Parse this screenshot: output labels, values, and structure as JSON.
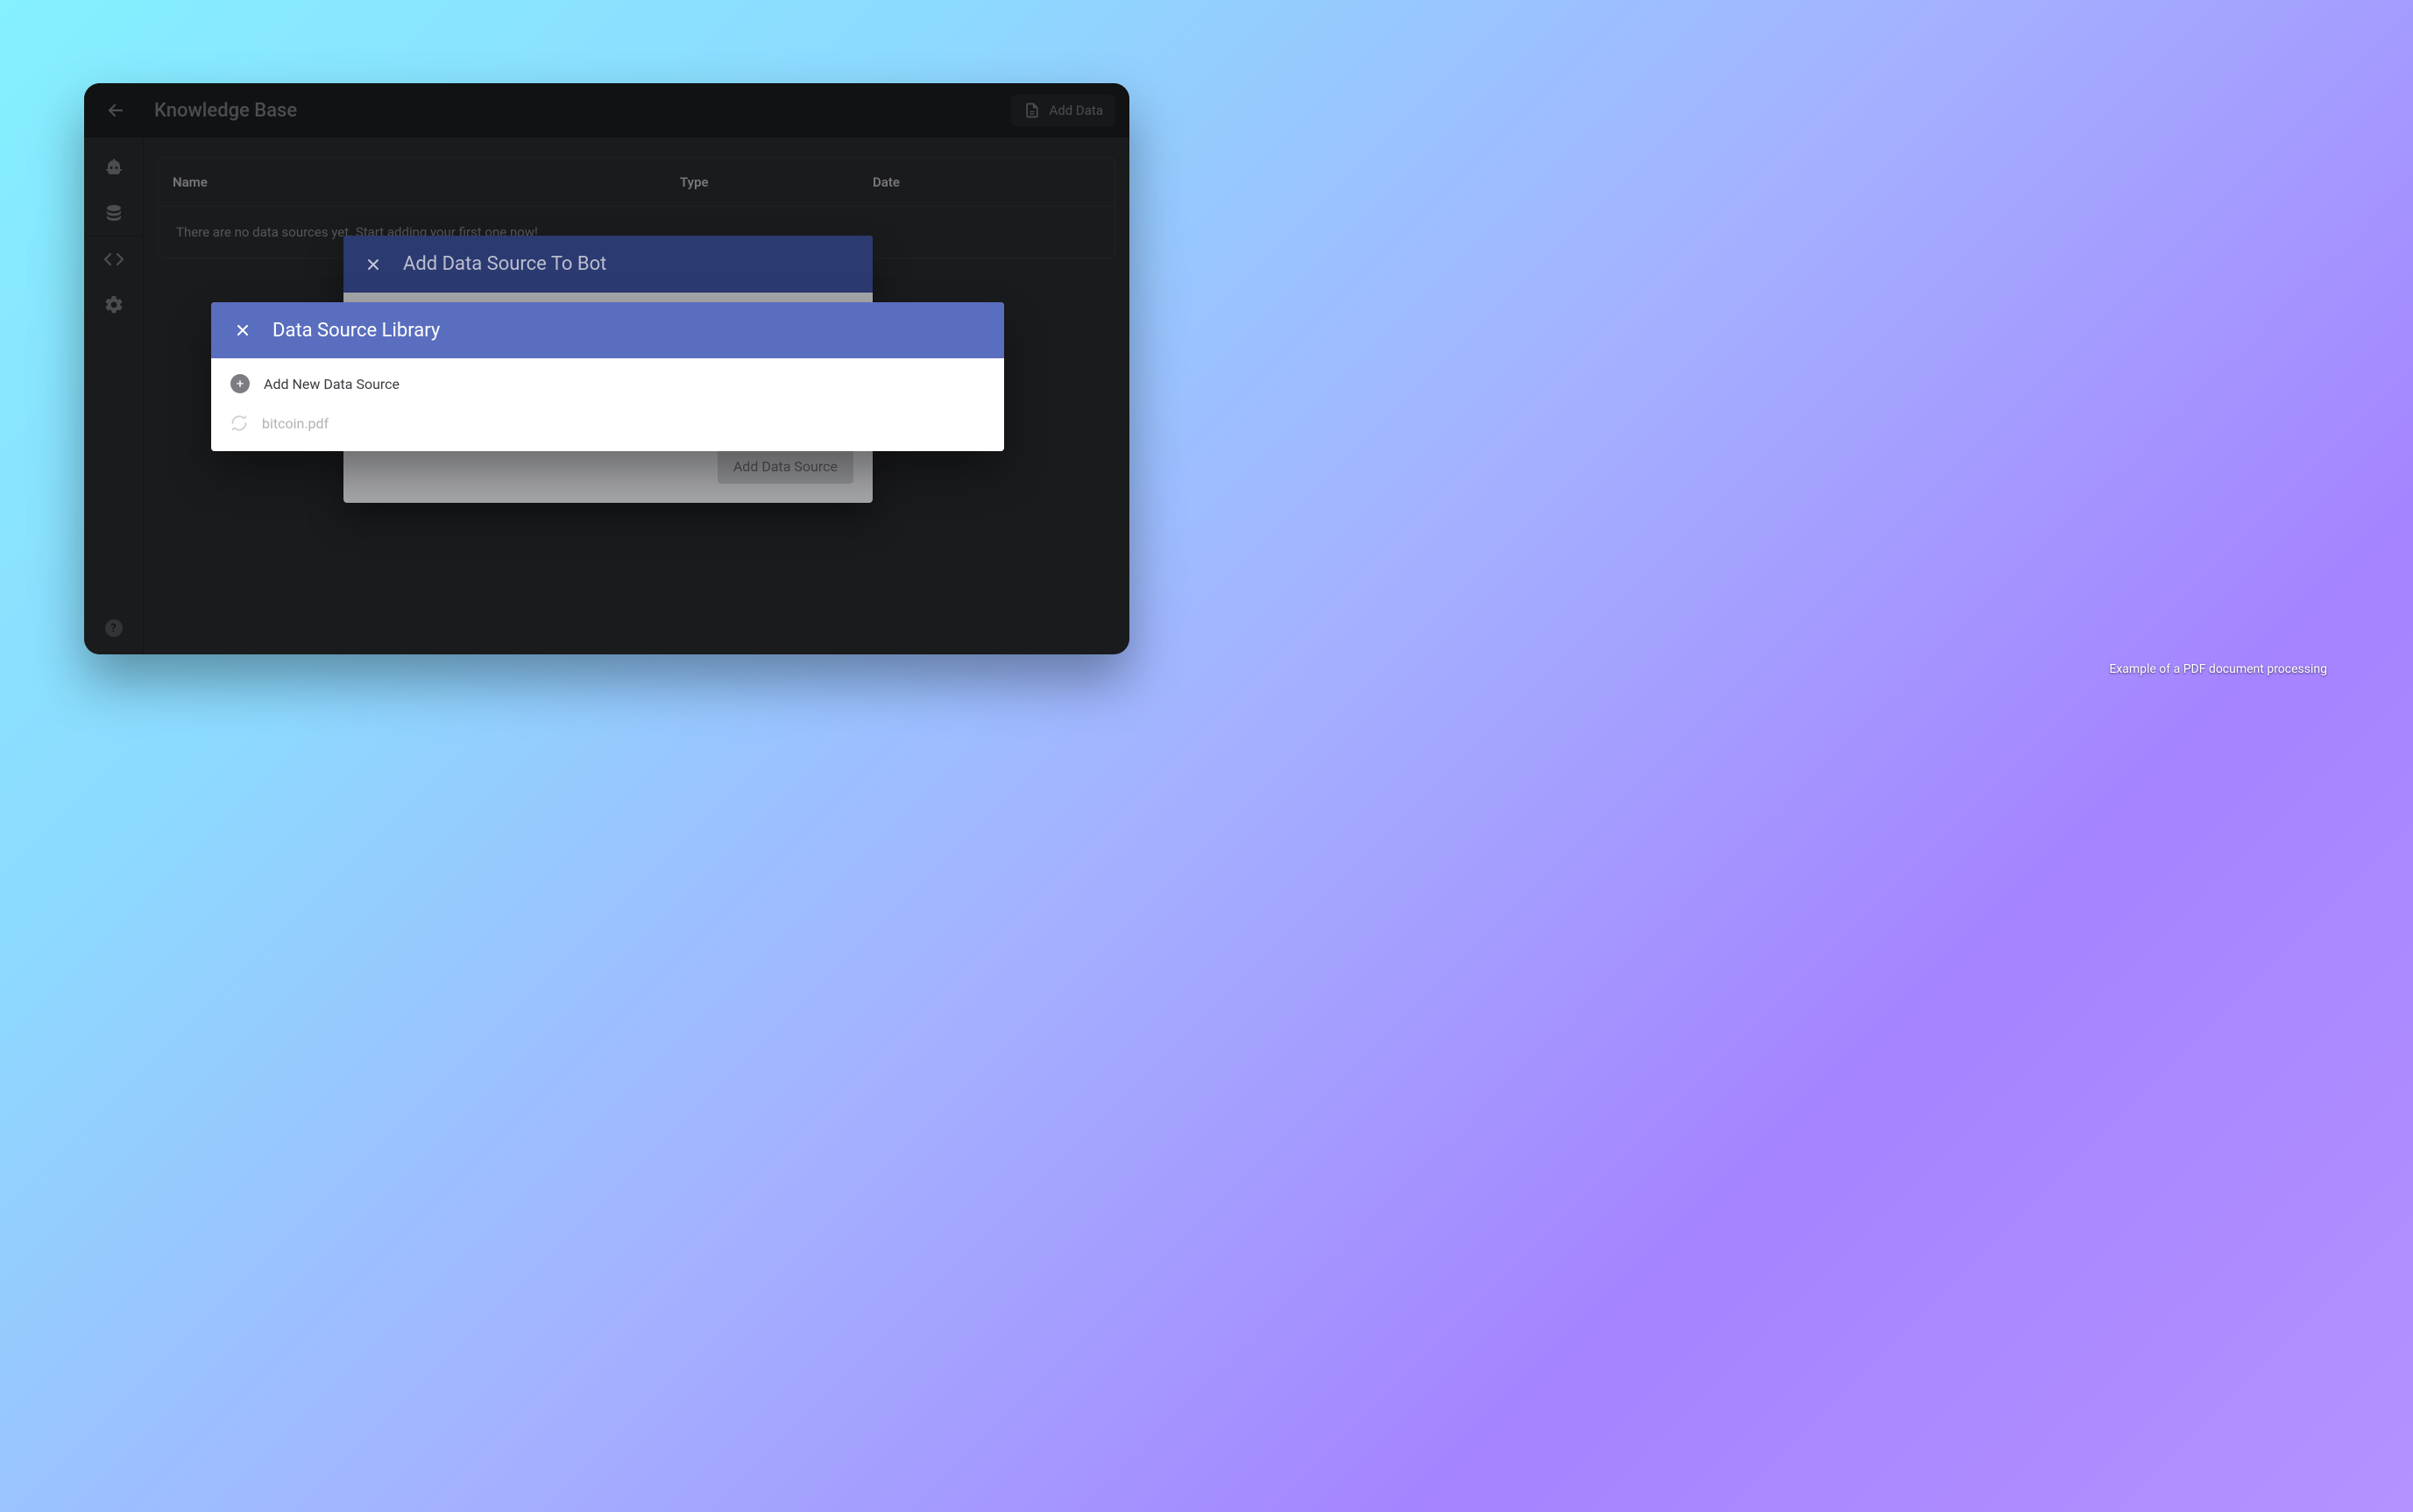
{
  "header": {
    "title": "Knowledge Base",
    "add_button_label": "Add Data"
  },
  "table": {
    "columns": {
      "name": "Name",
      "type": "Type",
      "date": "Date"
    },
    "empty_message": "There are no data sources yet. Start adding your first one now!"
  },
  "modal_back": {
    "title": "Add Data Source To Bot",
    "action_label": "Add Data Source"
  },
  "modal_front": {
    "title": "Data Source Library",
    "items": [
      {
        "kind": "add",
        "label": "Add New Data Source"
      },
      {
        "kind": "file",
        "label": "bitcoin.pdf"
      }
    ]
  },
  "caption": "Example of a PDF document processing"
}
